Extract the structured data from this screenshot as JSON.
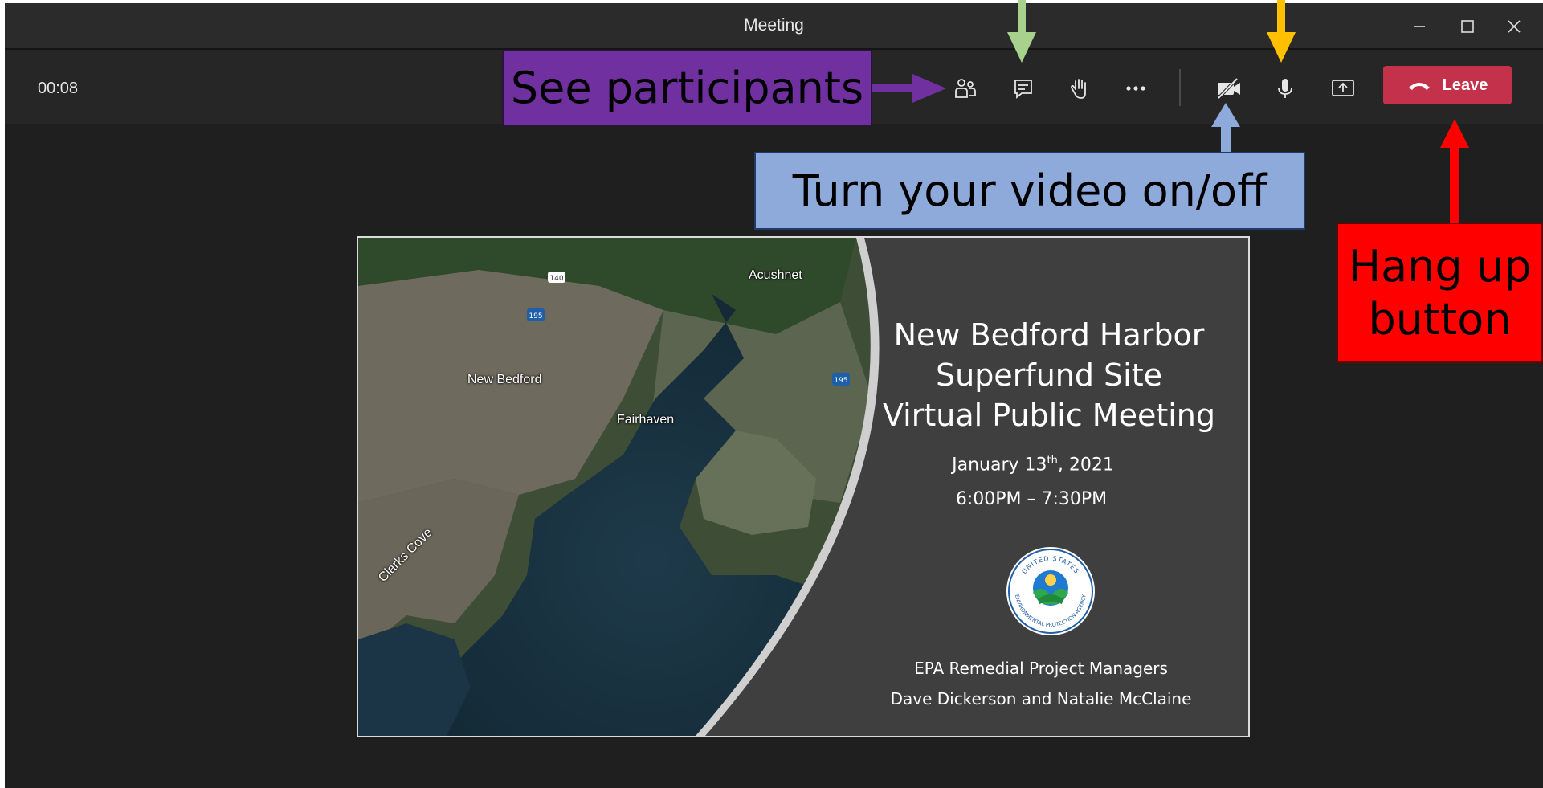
{
  "window": {
    "title": "Meeting"
  },
  "toolbar": {
    "timer": "00:08",
    "leave_label": "Leave",
    "buttons": [
      {
        "name": "participants-icon"
      },
      {
        "name": "chat-icon"
      },
      {
        "name": "raise-hand-icon"
      },
      {
        "name": "more-options-icon"
      },
      {
        "name": "camera-off-icon"
      },
      {
        "name": "microphone-icon"
      },
      {
        "name": "share-screen-icon"
      }
    ]
  },
  "slide": {
    "title_lines": [
      "New Bedford Harbor",
      "Superfund Site",
      "Virtual Public Meeting"
    ],
    "date_prefix": "January 13",
    "date_sup": "th",
    "date_suffix": ", 2021",
    "time": "6:00PM – 7:30PM",
    "seal_text_top": "UNITED STATES",
    "seal_text_bottom": "ENVIRONMENTAL PROTECTION AGENCY",
    "managers_line1": "EPA Remedial Project Managers",
    "managers_line2": "Dave Dickerson and Natalie McClaine",
    "map_labels": {
      "acushnet": "Acushnet",
      "new_bedford": "New Bedford",
      "fairhaven": "Fairhaven",
      "clarks_cove": "Clarks Cove",
      "route_140": "140",
      "i195_west": "195",
      "i195_east": "195"
    }
  },
  "annotations": {
    "see_participants": "See participants",
    "video_toggle": "Turn your video on/off",
    "hang_up_line1": "Hang up",
    "hang_up_line2": "button"
  },
  "colors": {
    "leave_red": "#c4314b",
    "callout_purple": "#7030a0",
    "callout_blue": "#8eaadb",
    "callout_red": "#ff0000",
    "arrow_green": "#a9d18e",
    "arrow_yellow": "#ffc000",
    "arrow_purple": "#7030a0",
    "arrow_blue": "#8eaadb"
  }
}
